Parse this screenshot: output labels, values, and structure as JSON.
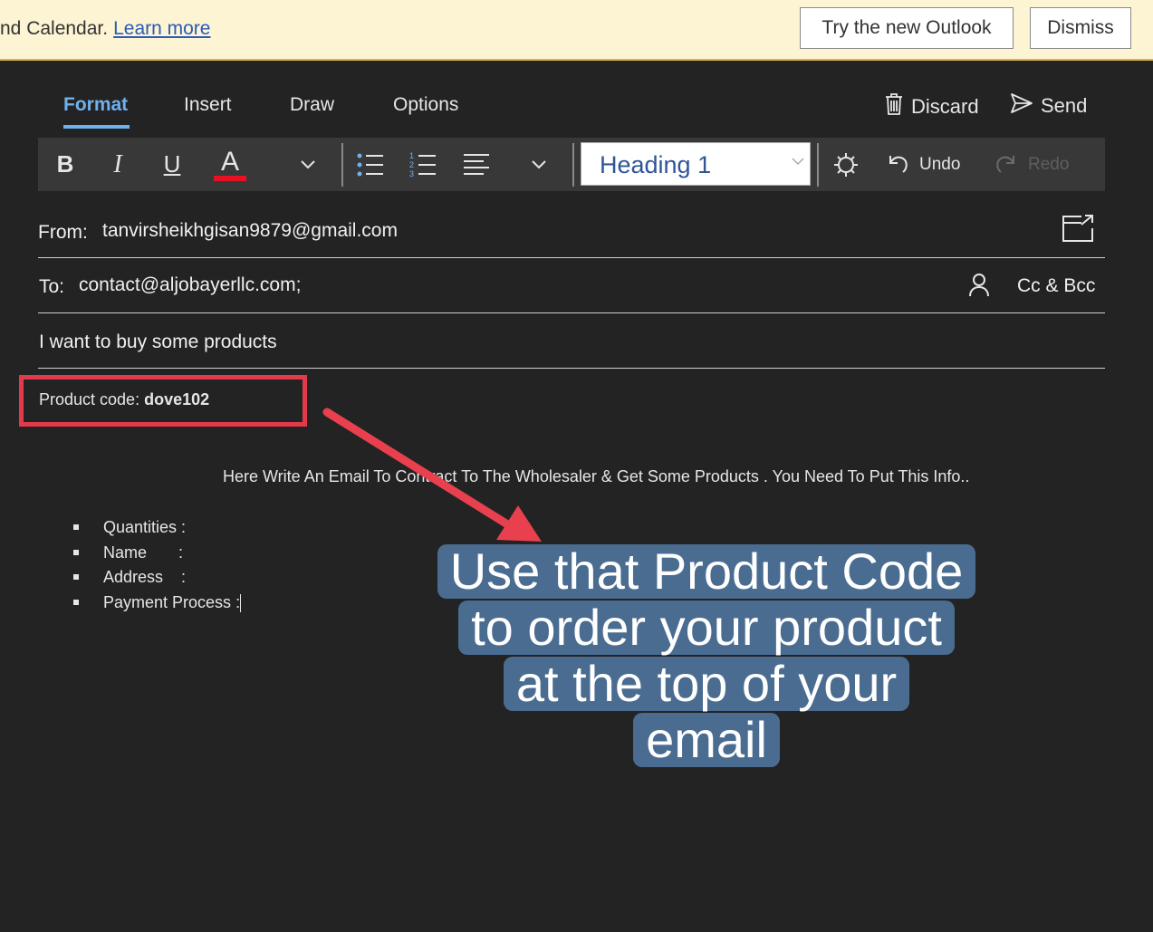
{
  "banner": {
    "text": "nd Calendar.",
    "link": "Learn more",
    "try_button": "Try the new Outlook",
    "dismiss_button": "Dismiss"
  },
  "tabs": [
    {
      "label": "Format",
      "active": true
    },
    {
      "label": "Insert",
      "active": false
    },
    {
      "label": "Draw",
      "active": false
    },
    {
      "label": "Options",
      "active": false
    }
  ],
  "commands": {
    "discard": "Discard",
    "send": "Send"
  },
  "toolbar": {
    "bold": "B",
    "italic": "I",
    "underline": "U",
    "font_color": "A",
    "font_color_value": "#e81123",
    "style_value": "Heading 1",
    "undo": "Undo",
    "redo": "Redo"
  },
  "compose": {
    "from_label": "From:",
    "from_value": "tanvirsheikhgisan9879@gmail.com",
    "to_label": "To:",
    "to_value": "contact@aljobayerllc.com;",
    "cc_bcc": "Cc & Bcc",
    "subject": "I want to buy some products"
  },
  "body": {
    "product_code_label": "Product code:",
    "product_code_value": "dove102",
    "instruction": "Here Write An Email To Contract To The Wholesaler & Get Some Products . You Need To Put This Info..",
    "list": [
      {
        "label": "Quantities",
        "suffix": " :"
      },
      {
        "label": "Name",
        "suffix": "       :"
      },
      {
        "label": "Address",
        "suffix": "    :"
      },
      {
        "label": "Payment Process",
        "suffix": " :"
      }
    ]
  },
  "caption": {
    "lines": [
      "Use that Product Code",
      "to order your product",
      "at the top of your",
      "email"
    ]
  },
  "colors": {
    "accent": "#6fb1ee",
    "highlight_box": "#e23a4a",
    "arrow": "#e8404e",
    "caption_bg": "#4a6c91",
    "banner_bg": "#fdf4d3"
  }
}
